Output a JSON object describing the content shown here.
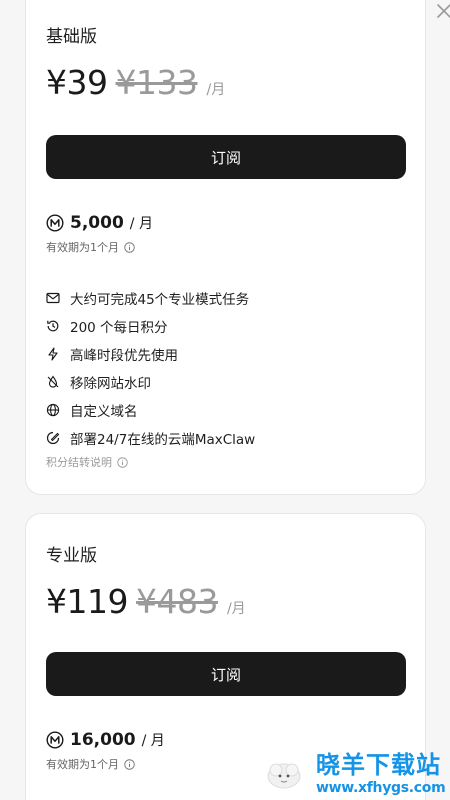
{
  "close_icon": "close-icon",
  "plans": [
    {
      "name": "基础版",
      "price": "¥39",
      "original_price": "¥133",
      "period": "/月",
      "subscribe_label": "订阅",
      "credits_amount": "5,000",
      "credits_unit": "/ 月",
      "validity": "有效期为1个月",
      "features": [
        {
          "icon": "mail-icon",
          "text": "大约可完成45个专业模式任务"
        },
        {
          "icon": "history-icon",
          "text": "200 个每日积分"
        },
        {
          "icon": "lightning-icon",
          "text": "高峰时段优先使用"
        },
        {
          "icon": "no-watermark-icon",
          "text": "移除网站水印"
        },
        {
          "icon": "globe-icon",
          "text": "自定义域名"
        },
        {
          "icon": "cloud-deploy-icon",
          "text": "部署24/7在线的云端MaxClaw"
        }
      ],
      "credits_explanation": "积分结转说明"
    },
    {
      "name": "专业版",
      "price": "¥119",
      "original_price": "¥483",
      "period": "/月",
      "subscribe_label": "订阅",
      "credits_amount": "16,000",
      "credits_unit": "/ 月",
      "validity": "有效期为1个月"
    }
  ],
  "watermark": {
    "title": "晓羊下载站",
    "url": "www.xfhygs.com"
  },
  "colors": {
    "accent": "#1a1a1a",
    "muted": "#9a9a9a",
    "watermark": "#1593e6"
  }
}
